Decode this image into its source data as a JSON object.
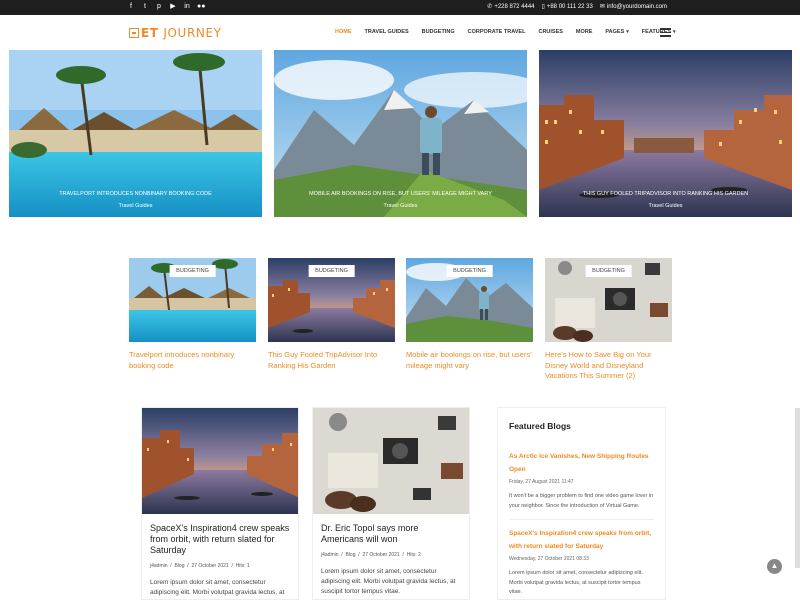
{
  "topbar": {
    "social_icons": [
      "facebook-icon",
      "twitter-icon",
      "pinterest-icon",
      "youtube-icon",
      "linkedin-icon",
      "flickr-icon"
    ],
    "social_glyphs": [
      "f",
      "t",
      "p",
      "▶",
      "in",
      "●●"
    ],
    "phone1": "+228 872 4444",
    "phone2": "+88 00 111 22 33",
    "email": "info@yourdomain.com"
  },
  "header": {
    "logo_prefix": "ET",
    "logo_word": "JOURNEY",
    "nav": [
      "HOME",
      "TRAVEL GUIDES",
      "BUDGETING",
      "CORPORATE TRAVEL",
      "CRUISES",
      "MORE",
      "PAGES",
      "FEATURES"
    ]
  },
  "hero": [
    {
      "caption": "TRAVELPORT INTRODUCES NONBINARY BOOKING CODE",
      "category": "Travel Guides"
    },
    {
      "caption": "MOBILE AIR BOOKINGS ON RISE, BUT USERS' MILEAGE MIGHT VARY",
      "category": "Travel Guides"
    },
    {
      "caption": "THIS GUY FOOLED TRIPADVISOR INTO RANKING HIS GARDEN",
      "category": "Travel Guides"
    }
  ],
  "cards": [
    {
      "badge": "BUDGETING",
      "title": "Travelport introduces nonbinary booking code"
    },
    {
      "badge": "BUDGETING",
      "title": "This Guy Fooled TripAdvisor Into Ranking His Garden"
    },
    {
      "badge": "BUDGETING",
      "title": "Mobile air bookings on rise, but users' mileage might vary"
    },
    {
      "badge": "BUDGETING",
      "title": "Here's How to Save Big on Your Disney World and Disneyland Vacations This Summer (2)"
    }
  ],
  "posts": [
    {
      "title": "SpaceX's Inspiration4 crew speaks from orbit, with return slated for Saturday",
      "author": "j4admin",
      "category": "Blog",
      "date": "27 October 2021",
      "hits": "Hits: 1",
      "excerpt": "Lorem ipsum dolor sit amet, consectetur adipiscing elit. Morbi volutpat gravida lectus, at"
    },
    {
      "title": "Dr. Eric Topol says more Americans will won",
      "author": "j4admin",
      "category": "Blog",
      "date": "27 October 2021",
      "hits": "Hits: 2",
      "excerpt": "Lorem ipsum dolor sit amet, consectetur adipiscing elit. Morbi volutpat gravida lectus, at suscipit tortor tempus vitae."
    }
  ],
  "sidebar": {
    "heading": "Featured Blogs",
    "items": [
      {
        "title": "As Arctic Ice Vanishes, New Shipping Routes Open",
        "date": "Friday, 27 August 2021 11:47",
        "excerpt": "It won't be a bigger problem to find one video game lover in your neighbor. Since the introduction of Virtual Game."
      },
      {
        "title": "SpaceX's Inspiration4 crew speaks from orbit, with return slated for Saturday",
        "date": "Wednesday, 27 October 2021 08:33",
        "excerpt": "Lorem ipsum dolor sit amet, consectetur adipiscing elit. Morbi volutpat gravida lectus, at suscipit tortor tempus vitae."
      }
    ]
  },
  "colors": {
    "accent": "#f08a24",
    "topbar": "#1e1e1e"
  },
  "scroll_top_icon": "chevron-up-icon",
  "scroll_top_glyph": "▲"
}
